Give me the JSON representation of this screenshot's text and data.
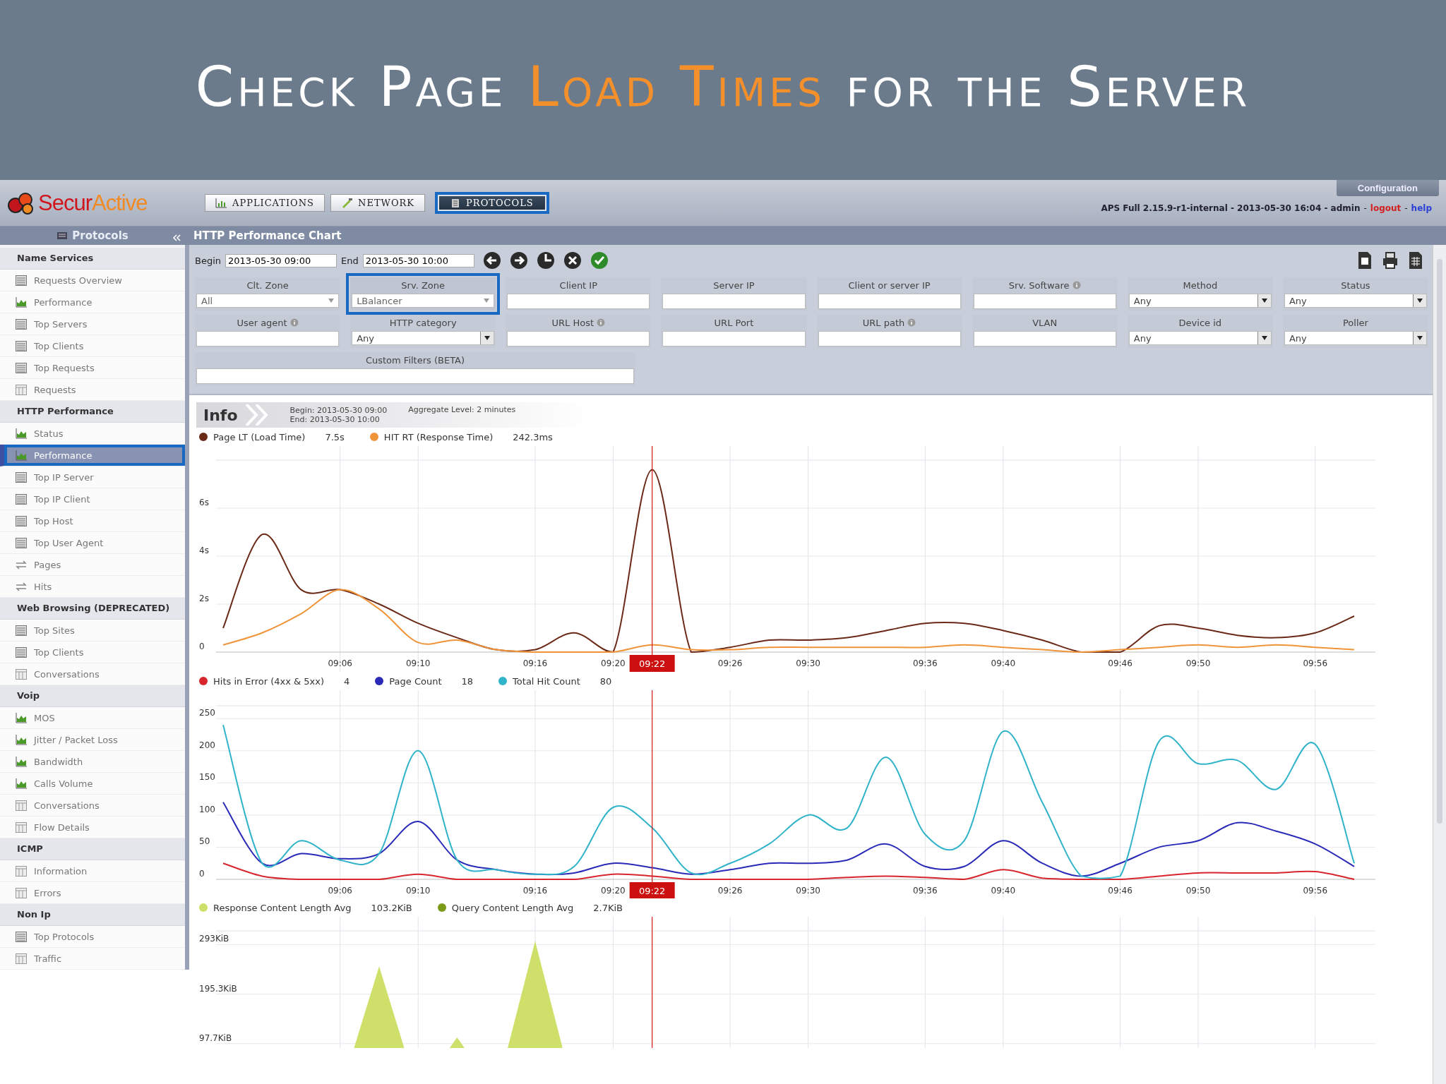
{
  "slide": {
    "title": [
      {
        "text": "Check Page ",
        "highlight": false
      },
      {
        "text": "Load Times",
        "highlight": true
      },
      {
        "text": " for the Server",
        "highlight": false
      }
    ]
  },
  "header": {
    "logo": [
      "Secur",
      "Active"
    ],
    "tabs": [
      {
        "label": "APPLICATIONS",
        "kind": "applications",
        "selected": false,
        "callout": false
      },
      {
        "label": "NETWORK",
        "kind": "network",
        "selected": false,
        "callout": false
      },
      {
        "label": "PROTOCOLS",
        "kind": "protocols",
        "selected": true,
        "callout": true
      }
    ],
    "config_button": "Configuration",
    "status": {
      "text": "APS Full 2.15.9-r1-internal - 2013-05-30 16:04 - admin",
      "separator": "-",
      "links": [
        {
          "label": "logout",
          "kind": "danger"
        },
        {
          "label": "help",
          "kind": "info"
        }
      ]
    }
  },
  "sidebar": {
    "title": "Protocols",
    "sections": [
      {
        "title": "Name Services",
        "items": [
          {
            "label": "Requests Overview",
            "kind": "table",
            "selected": false,
            "callout": false
          },
          {
            "label": "Performance",
            "kind": "chart",
            "selected": false,
            "callout": false
          },
          {
            "label": "Top Servers",
            "kind": "table",
            "selected": false,
            "callout": false
          },
          {
            "label": "Top Clients",
            "kind": "table",
            "selected": false,
            "callout": false
          },
          {
            "label": "Top Requests",
            "kind": "table",
            "selected": false,
            "callout": false
          },
          {
            "label": "Requests",
            "kind": "grid",
            "selected": false,
            "callout": false
          }
        ]
      },
      {
        "title": "HTTP Performance",
        "items": [
          {
            "label": "Status",
            "kind": "chart",
            "selected": false,
            "callout": false
          },
          {
            "label": "Performance",
            "kind": "chart",
            "selected": true,
            "callout": true
          },
          {
            "label": "Top IP Server",
            "kind": "table",
            "selected": false,
            "callout": false
          },
          {
            "label": "Top IP Client",
            "kind": "table",
            "selected": false,
            "callout": false
          },
          {
            "label": "Top Host",
            "kind": "table",
            "selected": false,
            "callout": false
          },
          {
            "label": "Top User Agent",
            "kind": "table",
            "selected": false,
            "callout": false
          },
          {
            "label": "Pages",
            "kind": "arrows",
            "selected": false,
            "callout": false
          },
          {
            "label": "Hits",
            "kind": "arrows",
            "selected": false,
            "callout": false
          }
        ]
      },
      {
        "title": "Web Browsing (DEPRECATED)",
        "items": [
          {
            "label": "Top Sites",
            "kind": "table",
            "selected": false,
            "callout": false
          },
          {
            "label": "Top Clients",
            "kind": "table",
            "selected": false,
            "callout": false
          },
          {
            "label": "Conversations",
            "kind": "grid",
            "selected": false,
            "callout": false
          }
        ]
      },
      {
        "title": "Voip",
        "items": [
          {
            "label": "MOS",
            "kind": "chart",
            "selected": false,
            "callout": false
          },
          {
            "label": "Jitter / Packet Loss",
            "kind": "chart",
            "selected": false,
            "callout": false
          },
          {
            "label": "Bandwidth",
            "kind": "chart",
            "selected": false,
            "callout": false
          },
          {
            "label": "Calls Volume",
            "kind": "chart",
            "selected": false,
            "callout": false
          },
          {
            "label": "Conversations",
            "kind": "grid",
            "selected": false,
            "callout": false
          },
          {
            "label": "Flow Details",
            "kind": "grid",
            "selected": false,
            "callout": false
          }
        ]
      },
      {
        "title": "ICMP",
        "items": [
          {
            "label": "Information",
            "kind": "grid",
            "selected": false,
            "callout": false
          },
          {
            "label": "Errors",
            "kind": "grid",
            "selected": false,
            "callout": false
          }
        ]
      },
      {
        "title": "Non Ip",
        "items": [
          {
            "label": "Top Protocols",
            "kind": "table",
            "selected": false,
            "callout": false
          },
          {
            "label": "Traffic",
            "kind": "grid",
            "selected": false,
            "callout": false
          }
        ]
      }
    ]
  },
  "panel": {
    "title": "HTTP Performance Chart"
  },
  "toolbar": {
    "begin_label": "Begin",
    "begin_value": "2013-05-30 09:00",
    "end_label": "End",
    "end_value": "2013-05-30 10:00",
    "buttons": [
      {
        "kind": "previous"
      },
      {
        "kind": "next"
      },
      {
        "kind": "clock"
      },
      {
        "kind": "cancel"
      },
      {
        "kind": "apply"
      }
    ],
    "exports": [
      {
        "kind": "document"
      },
      {
        "kind": "print"
      },
      {
        "kind": "csv"
      }
    ]
  },
  "filter_rows": [
    {
      "fields": [
        {
          "label": "Clt. Zone",
          "kind": "combo",
          "value": "All",
          "info": false,
          "callout": false
        },
        {
          "label": "Srv. Zone",
          "kind": "combo",
          "value": "LBalancer",
          "info": false,
          "callout": true
        },
        {
          "label": "Client IP",
          "kind": "text",
          "info": false,
          "callout": false
        },
        {
          "label": "Server IP",
          "kind": "text",
          "info": false,
          "callout": false
        },
        {
          "label": "Client or server IP",
          "kind": "text",
          "info": false,
          "callout": false
        },
        {
          "label": "Srv. Software",
          "kind": "text",
          "info": true,
          "callout": false
        },
        {
          "label": "Method",
          "kind": "select",
          "value": "Any",
          "info": false,
          "callout": false
        },
        {
          "label": "Status",
          "kind": "select",
          "value": "Any",
          "info": false,
          "callout": false
        }
      ]
    },
    {
      "fields": [
        {
          "label": "User agent",
          "kind": "text",
          "info": true,
          "callout": false
        },
        {
          "label": "HTTP category",
          "kind": "select",
          "value": "Any",
          "info": false,
          "callout": false
        },
        {
          "label": "URL Host",
          "kind": "text",
          "info": true,
          "callout": false
        },
        {
          "label": "URL Port",
          "kind": "text",
          "info": false,
          "callout": false
        },
        {
          "label": "URL path",
          "kind": "text",
          "info": true,
          "callout": false
        },
        {
          "label": "VLAN",
          "kind": "text",
          "info": false,
          "callout": false
        },
        {
          "label": "Device id",
          "kind": "select",
          "value": "Any",
          "info": false,
          "callout": false
        },
        {
          "label": "Poller",
          "kind": "select",
          "value": "Any",
          "info": false,
          "callout": false
        }
      ]
    },
    {
      "fields": [
        {
          "label": "Custom Filters (BETA)",
          "kind": "text",
          "info": false,
          "callout": false
        }
      ]
    }
  ],
  "info": {
    "title": "Info",
    "begin": "Begin: 2013-05-30 09:00",
    "end": "End: 2013-05-30 10:00",
    "aggregate": "Aggregate Level: 2 minutes"
  },
  "charts": [
    {
      "readings": [
        "7.5s",
        "242.3ms"
      ],
      "chart_data": {
        "type": "line",
        "categories": [
          null,
          null,
          null,
          "09:06",
          null,
          "09:10",
          null,
          null,
          "09:16",
          null,
          "09:20",
          "09:22",
          null,
          "09:26",
          null,
          "09:30",
          null,
          null,
          "09:36",
          null,
          "09:40",
          null,
          null,
          "09:46",
          null,
          "09:50",
          null,
          null,
          "09:56",
          null
        ],
        "grid": true,
        "ylim": [
          0,
          8
        ],
        "yticks": [
          {
            "value": 0,
            "label": "0"
          },
          {
            "value": 2,
            "label": "2s"
          },
          {
            "value": 4,
            "label": "4s"
          },
          {
            "value": 6,
            "label": "6s"
          }
        ],
        "series": [
          {
            "name": "Page LT (Load Time)",
            "color": "#6b2a18",
            "values": [
              1.0,
              4.9,
              2.6,
              2.6,
              2.0,
              1.2,
              0.6,
              0.1,
              0.1,
              0.8,
              0,
              7.6,
              0,
              0.2,
              0.5,
              0.5,
              0.6,
              0.9,
              1.2,
              1.2,
              0.9,
              0.5,
              0,
              0,
              1.1,
              1.0,
              0.7,
              0.6,
              0.8,
              1.5
            ]
          },
          {
            "name": "HIT RT (Response Time)",
            "color": "#f0943a",
            "values": [
              0.3,
              0.8,
              1.6,
              2.6,
              1.8,
              0.4,
              0.5,
              0.1,
              0,
              0,
              0,
              0.3,
              0.1,
              0.1,
              0.2,
              0.2,
              0.2,
              0.2,
              0.2,
              0.3,
              0.2,
              0.1,
              0,
              0.1,
              0.2,
              0.3,
              0.2,
              0.3,
              0.2,
              0.1
            ]
          }
        ],
        "annotations": [
          {
            "x": "09:22"
          }
        ]
      }
    },
    {
      "readings": [
        "4",
        "18",
        "80"
      ],
      "chart_data": {
        "type": "line",
        "categories": [
          null,
          null,
          null,
          "09:06",
          null,
          "09:10",
          null,
          null,
          "09:16",
          null,
          "09:20",
          "09:22",
          null,
          "09:26",
          null,
          "09:30",
          null,
          null,
          "09:36",
          null,
          "09:40",
          null,
          null,
          "09:46",
          null,
          "09:50",
          null,
          null,
          "09:56",
          null
        ],
        "grid": true,
        "ylim": [
          0,
          270
        ],
        "yticks": [
          0,
          50,
          100,
          150,
          200,
          250
        ],
        "series": [
          {
            "name": "Hits in Error (4xx & 5xx)",
            "color": "#d8262e",
            "values": [
              25,
              5,
              0,
              0,
              0,
              8,
              0,
              0,
              0,
              0,
              8,
              5,
              0,
              0,
              0,
              0,
              3,
              5,
              3,
              0,
              15,
              2,
              0,
              0,
              5,
              10,
              10,
              10,
              12,
              0
            ]
          },
          {
            "name": "Page Count",
            "color": "#2a2ab8",
            "values": [
              120,
              25,
              40,
              32,
              40,
              90,
              30,
              15,
              8,
              10,
              25,
              18,
              8,
              15,
              25,
              25,
              30,
              55,
              20,
              20,
              60,
              25,
              5,
              25,
              50,
              60,
              88,
              75,
              55,
              20
            ]
          },
          {
            "name": "Total Hit Count",
            "color": "#31b3c9",
            "values": [
              240,
              25,
              60,
              30,
              40,
              200,
              30,
              15,
              8,
              20,
              112,
              80,
              10,
              25,
              55,
              100,
              80,
              190,
              70,
              60,
              230,
              120,
              5,
              5,
              215,
              180,
              185,
              140,
              210,
              25
            ]
          }
        ],
        "annotations": [
          {
            "x": "09:22"
          }
        ]
      }
    },
    {
      "readings": [
        "103.2KiB",
        "2.7KiB"
      ],
      "chart_data": {
        "type": "area",
        "categories": [
          null,
          null,
          null,
          null,
          null,
          null,
          null,
          null,
          null,
          null,
          null,
          null,
          null,
          null,
          null,
          null,
          null,
          null,
          null,
          null,
          null,
          null,
          null,
          null,
          null,
          null,
          null,
          null,
          null,
          null
        ],
        "grid": true,
        "ylim": [
          0,
          320
        ],
        "yticks": [
          {
            "value": 97.7,
            "label": "97.7KiB"
          },
          {
            "value": 195.3,
            "label": "195.3KiB"
          },
          {
            "value": 293,
            "label": "293KiB"
          }
        ],
        "series": [
          {
            "name": "Response Content Length Avg",
            "color": "#cfe06a",
            "values": [
              0,
              0,
              0,
              0,
              250,
              0,
              110,
              0,
              300,
              0,
              0,
              0,
              0,
              0,
              0,
              0,
              0,
              0,
              0,
              0,
              0,
              0,
              0,
              0,
              0,
              0,
              0,
              0,
              0,
              0
            ]
          },
          {
            "name": "Query Content Length Avg",
            "color": "#7a9a1a",
            "values": [
              null,
              null,
              null,
              null,
              null,
              null,
              null,
              null,
              null,
              null,
              null,
              null,
              null,
              null,
              null,
              null,
              null,
              null,
              null,
              null,
              null,
              null,
              null,
              null,
              null,
              null,
              null,
              null,
              null,
              null
            ]
          }
        ]
      }
    }
  ]
}
